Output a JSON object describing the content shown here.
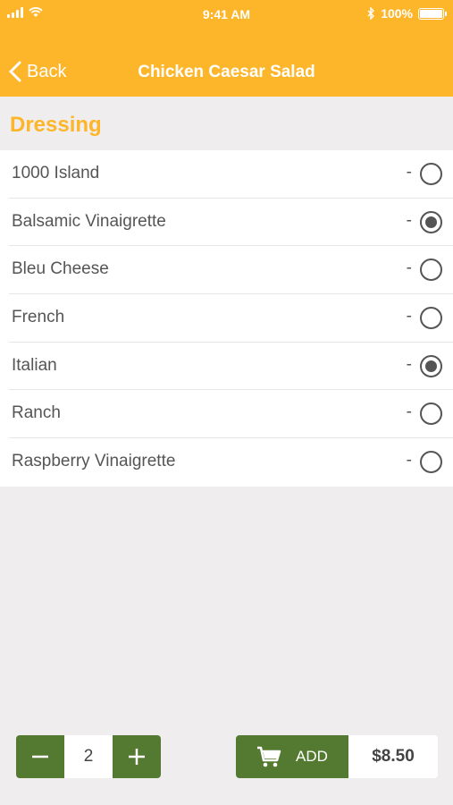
{
  "status": {
    "time": "9:41 AM",
    "battery": "100%"
  },
  "nav": {
    "back_label": "Back",
    "title": "Chicken Caesar Salad"
  },
  "section": {
    "title": "Dressing"
  },
  "options": [
    {
      "label": "1000 Island",
      "price": "-",
      "selected": false
    },
    {
      "label": "Balsamic Vinaigrette",
      "price": "-",
      "selected": true
    },
    {
      "label": "Bleu Cheese",
      "price": "-",
      "selected": false
    },
    {
      "label": "French",
      "price": "-",
      "selected": false
    },
    {
      "label": "Italian",
      "price": "-",
      "selected": true
    },
    {
      "label": "Ranch",
      "price": "-",
      "selected": false
    },
    {
      "label": "Raspberry Vinaigrette",
      "price": "-",
      "selected": false
    }
  ],
  "footer": {
    "quantity": "2",
    "add_label": "ADD",
    "price": "$8.50"
  },
  "colors": {
    "accent": "#fdb52a",
    "action": "#547a32",
    "background": "#efeded"
  }
}
